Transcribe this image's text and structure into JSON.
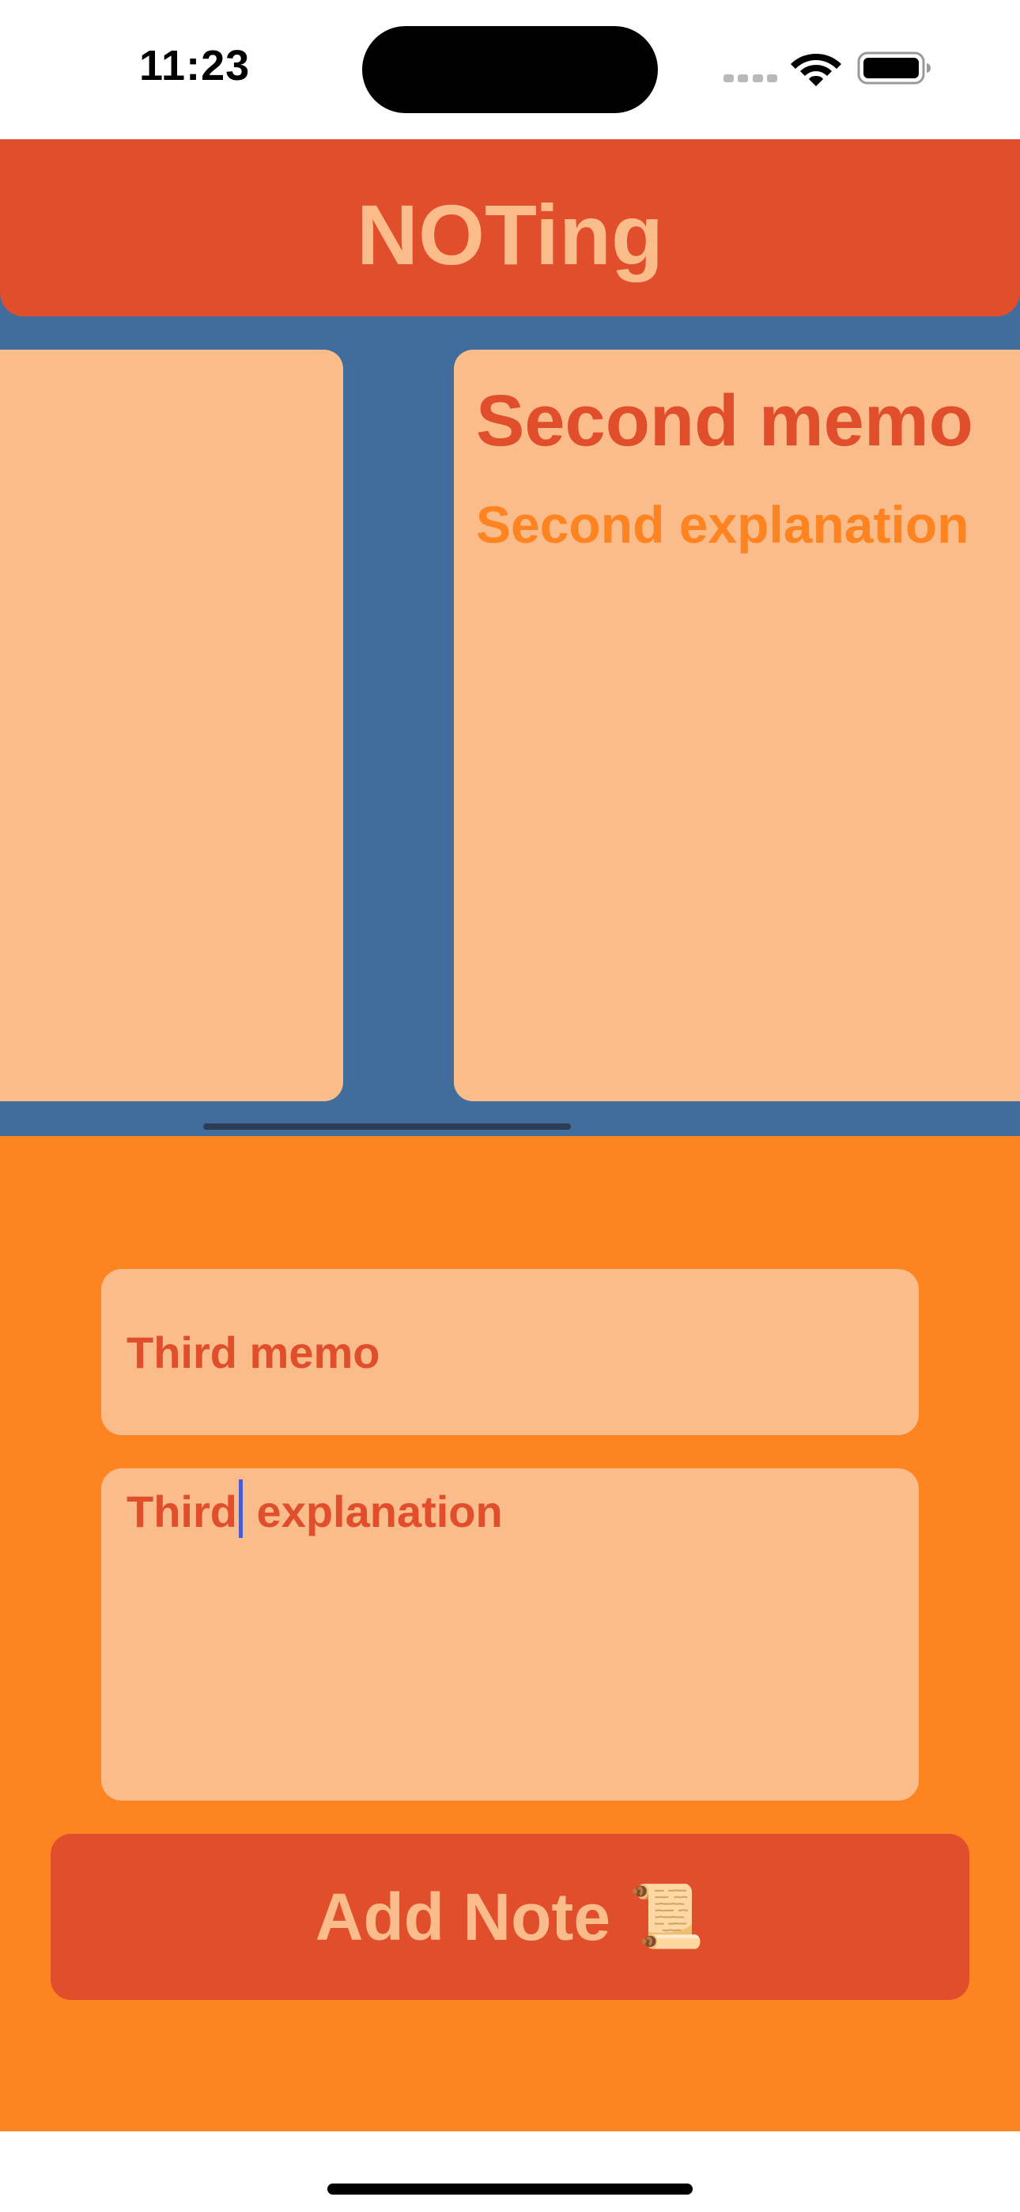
{
  "status_bar": {
    "time": "11:23"
  },
  "header": {
    "title": "NOTing"
  },
  "carousel": {
    "current_note": {
      "title": "Second memo",
      "body": "Second explanation"
    }
  },
  "composer": {
    "title_value": "Third memo",
    "body_value_before_cursor": "Third",
    "body_value_after_cursor": "explanation",
    "add_button_label": "Add Note",
    "add_button_emoji": "📜"
  },
  "icons": {
    "signal": "cellular-signal-icon",
    "wifi": "wifi-icon",
    "battery": "battery-icon",
    "add": "scroll-icon"
  },
  "colors": {
    "header_bg": "#e04e2b",
    "carousel_bg": "#406d9b",
    "card_bg": "#fbbc8b",
    "composer_bg": "#fd8420",
    "title_text": "#e04e2b",
    "body_text": "#fd8420",
    "caret": "#4a5bd4"
  }
}
